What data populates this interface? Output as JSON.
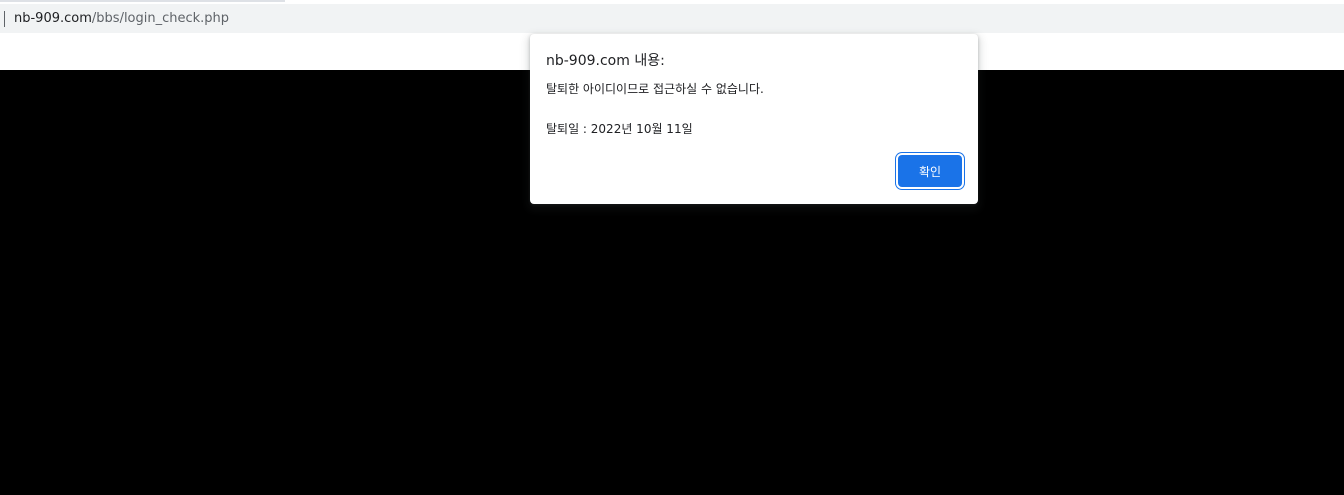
{
  "browser": {
    "url_host": "nb-909.com",
    "url_path": "/bbs/login_check.php"
  },
  "alert": {
    "title": "nb-909.com 내용:",
    "message_line1": "탈퇴한 아이디이므로 접근하실 수 없습니다.",
    "message_line2": "탈퇴일 : 2022년 10월 11일",
    "ok_label": "확인"
  },
  "colors": {
    "page_background": "#000000",
    "address_bar": "#f1f3f4",
    "button_accent": "#1a73e8"
  }
}
